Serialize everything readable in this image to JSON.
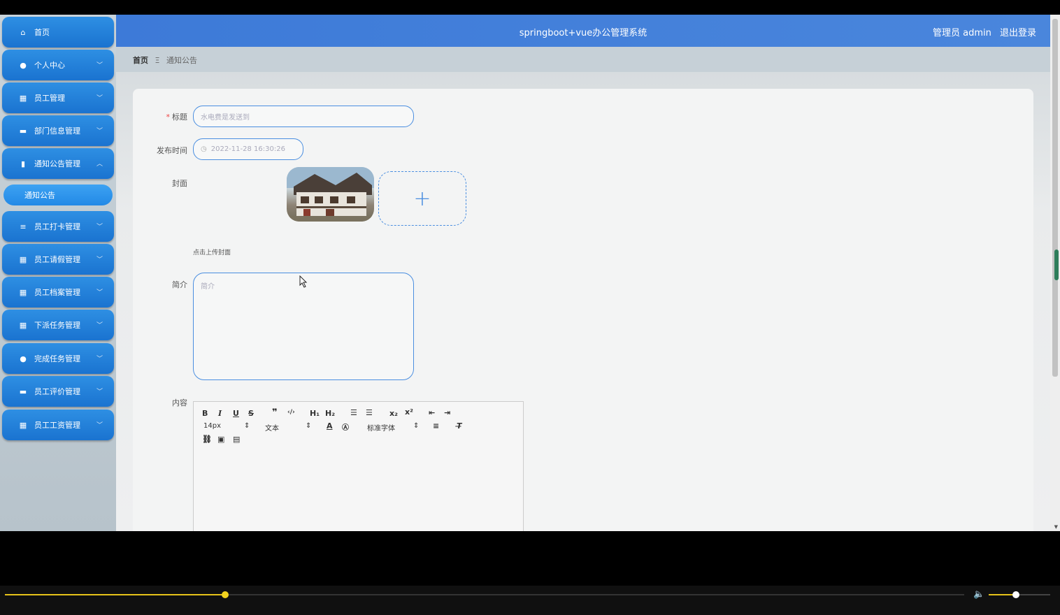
{
  "app": {
    "title": "springboot+vue办公管理系统",
    "user_label": "管理员 admin",
    "logout": "退出登录"
  },
  "breadcrumb": {
    "home": "首页",
    "separator": "Ξ",
    "current": "通知公告"
  },
  "sidebar": {
    "items": [
      {
        "label": "首页",
        "icon": "home-icon"
      },
      {
        "label": "个人中心",
        "icon": "user-icon"
      },
      {
        "label": "员工管理",
        "icon": "grid-icon"
      },
      {
        "label": "部门信息管理",
        "icon": "monitor-icon"
      },
      {
        "label": "通知公告管理",
        "icon": "bar-chart-icon"
      },
      {
        "label": "员工打卡管理",
        "icon": "list-icon"
      },
      {
        "label": "员工请假管理",
        "icon": "grid-icon"
      },
      {
        "label": "员工档案管理",
        "icon": "grid-icon"
      },
      {
        "label": "下派任务管理",
        "icon": "grid-icon"
      },
      {
        "label": "完成任务管理",
        "icon": "bulb-icon"
      },
      {
        "label": "员工评价管理",
        "icon": "chat-icon"
      },
      {
        "label": "员工工资管理",
        "icon": "grid-icon"
      }
    ],
    "sub_item": "通知公告"
  },
  "form": {
    "title_label": "标题",
    "title_placeholder": "水电费是发送到",
    "time_label": "发布时间",
    "time_value": "2022-11-28 16:30:26",
    "cover_label": "封面",
    "cover_hint": "点击上传封面",
    "upload_plus": "+",
    "intro_label": "简介",
    "intro_placeholder": "简介",
    "content_label": "内容"
  },
  "editor": {
    "font_size": "14px",
    "heading": "文本",
    "font_family": "标准字体"
  },
  "colors": {
    "accent": "#1a73d0",
    "header": "#3d7ad8",
    "seek": "#e6c21a"
  },
  "player": {
    "progress": 0.23,
    "volume": 0.44
  }
}
